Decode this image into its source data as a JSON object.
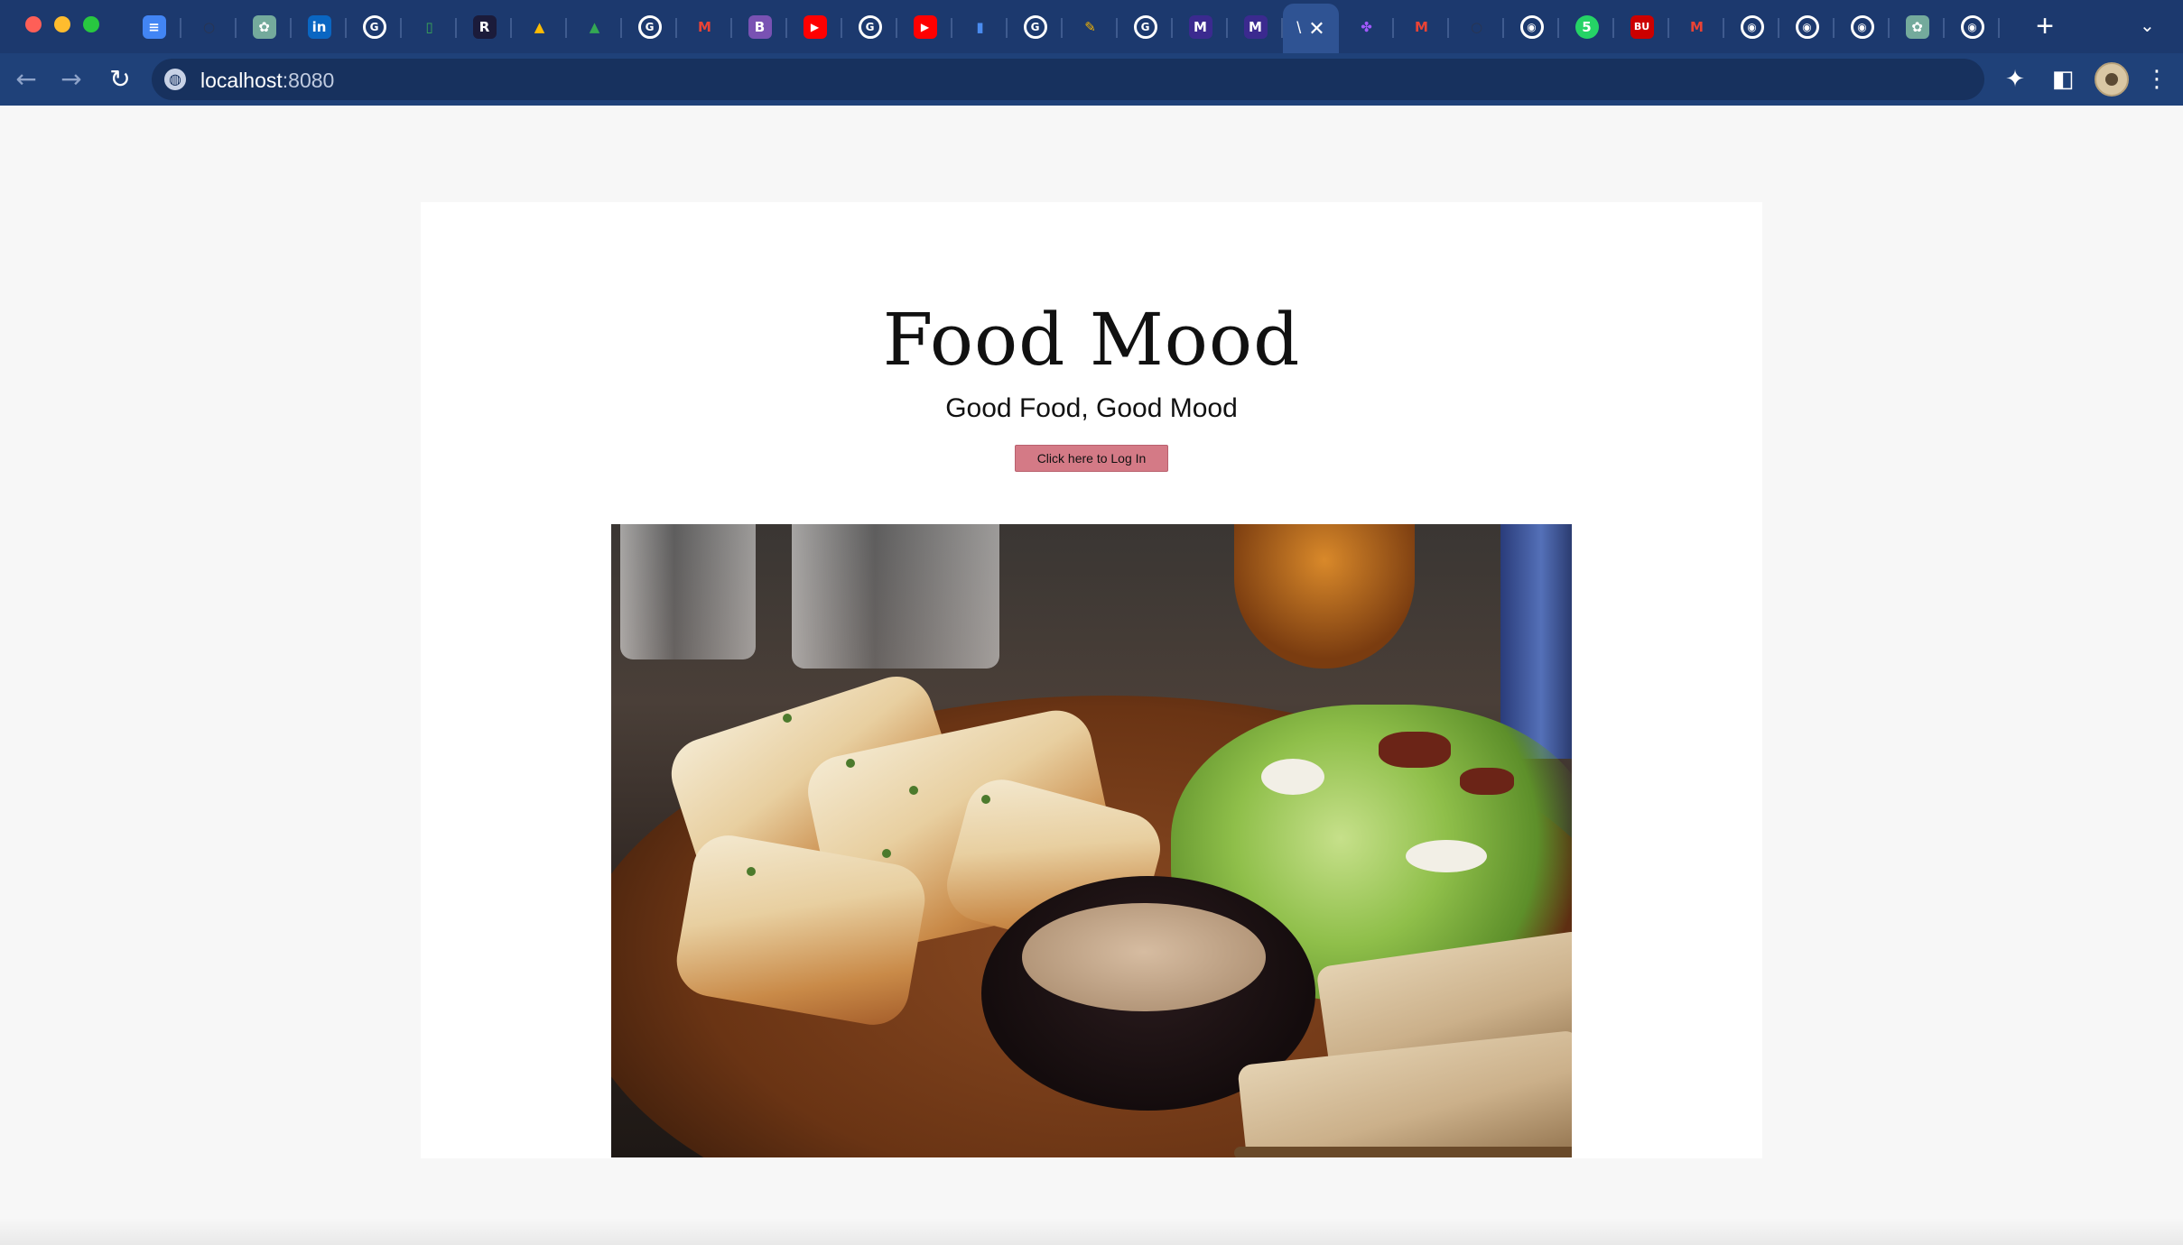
{
  "browser": {
    "tabs": [
      {
        "icon": "google-docs-icon",
        "glyph": "≡",
        "color": "#4285f4"
      },
      {
        "icon": "github-icon",
        "glyph": "○",
        "color": "#2a3550"
      },
      {
        "icon": "chatgpt-icon",
        "glyph": "✿",
        "color": "#74aa9c"
      },
      {
        "icon": "linkedin-icon",
        "glyph": "in",
        "color": "#0a66c2"
      },
      {
        "icon": "google-icon",
        "glyph": "G",
        "color": "#ffffff"
      },
      {
        "icon": "phone-icon",
        "glyph": "▯",
        "color": "#3aa757"
      },
      {
        "icon": "r-app-icon",
        "glyph": "R",
        "color": "#1b1b3a"
      },
      {
        "icon": "google-drive-icon",
        "glyph": "▲",
        "color": "#fbbc04"
      },
      {
        "icon": "google-drive-icon",
        "glyph": "▲",
        "color": "#34a853"
      },
      {
        "icon": "google-icon",
        "glyph": "G",
        "color": "#ffffff"
      },
      {
        "icon": "gmail-icon",
        "glyph": "M",
        "color": "#ea4335"
      },
      {
        "icon": "bootstrap-icon",
        "glyph": "B",
        "color": "#7952b3"
      },
      {
        "icon": "youtube-icon",
        "glyph": "▶",
        "color": "#ff0000"
      },
      {
        "icon": "google-icon",
        "glyph": "G",
        "color": "#ffffff"
      },
      {
        "icon": "youtube-icon",
        "glyph": "▶",
        "color": "#ff0000"
      },
      {
        "icon": "analytics-icon",
        "glyph": "▮",
        "color": "#4a8cf0"
      },
      {
        "icon": "google-icon",
        "glyph": "G",
        "color": "#ffffff"
      },
      {
        "icon": "notes-icon",
        "glyph": "✎",
        "color": "#f4b400"
      },
      {
        "icon": "google-icon",
        "glyph": "G",
        "color": "#ffffff"
      },
      {
        "icon": "m-app-icon",
        "glyph": "M",
        "color": "#3b2a8f"
      },
      {
        "icon": "m-app-icon",
        "glyph": "M",
        "color": "#3b2a8f"
      }
    ],
    "tabs_after": [
      {
        "icon": "figma-icon",
        "glyph": "✤",
        "color": "#a259ff"
      },
      {
        "icon": "gmail-icon",
        "glyph": "M",
        "color": "#ea4335"
      },
      {
        "icon": "github-icon",
        "glyph": "○",
        "color": "#2a3550"
      },
      {
        "icon": "chrome-icon",
        "glyph": "◉",
        "color": "#ffffff"
      },
      {
        "icon": "whatsapp-icon",
        "glyph": "5",
        "color": "#25d366"
      },
      {
        "icon": "bu-icon",
        "glyph": "BU",
        "color": "#cc0000"
      },
      {
        "icon": "gmail-icon",
        "glyph": "M",
        "color": "#ea4335"
      },
      {
        "icon": "chrome-icon",
        "glyph": "◉",
        "color": "#ffffff"
      },
      {
        "icon": "chrome-icon",
        "glyph": "◉",
        "color": "#ffffff"
      },
      {
        "icon": "chrome-icon",
        "glyph": "◉",
        "color": "#ffffff"
      },
      {
        "icon": "chatgpt-icon",
        "glyph": "✿",
        "color": "#74aa9c"
      },
      {
        "icon": "chrome-icon",
        "glyph": "◉",
        "color": "#ffffff"
      }
    ],
    "active_tab": {
      "title": "\\",
      "close": "✕"
    },
    "new_tab": "+",
    "tab_menu": "⌄",
    "url_host": "localhost",
    "url_port": ":8080"
  },
  "page": {
    "title": "Food Mood",
    "subtitle": "Good Food, Good Mood",
    "login_button": "Click here to Log In",
    "hero_image": "food-plate-photo"
  }
}
